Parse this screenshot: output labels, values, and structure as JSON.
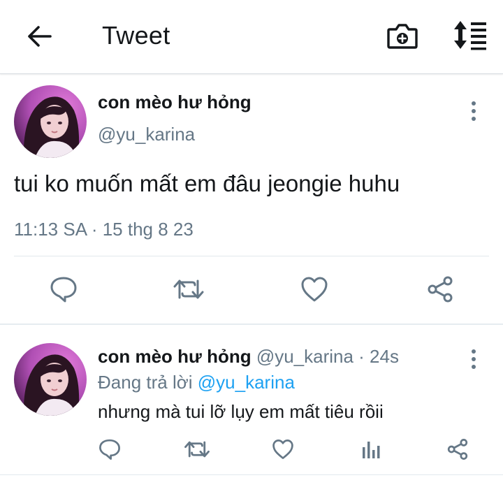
{
  "header": {
    "title": "Tweet",
    "back_icon": "arrow-left-icon",
    "camera_icon": "camera-plus-icon",
    "sort_icon": "sort-list-icon"
  },
  "main_tweet": {
    "display_name": "con mèo hư hỏng",
    "handle": "@yu_karina",
    "text": "tui ko muốn mất em đâu jeongie huhu",
    "timestamp": "11:13 SA · 15 thg 8 23",
    "actions": [
      "reply-icon",
      "retweet-icon",
      "like-icon",
      "share-icon"
    ]
  },
  "reply_tweet": {
    "display_name": "con mèo hư hỏng",
    "handle_time": " @yu_karina · 24s",
    "replying_prefix": "Đang trả lời ",
    "replying_to": "@yu_karina",
    "text": "nhưng mà tui lỡ lụy em mất tiêu rồii",
    "actions": [
      "reply-icon",
      "retweet-icon",
      "like-icon",
      "analytics-icon",
      "share-icon"
    ]
  },
  "colors": {
    "text": "#14171a",
    "secondary": "#657786",
    "link": "#1da1f2",
    "divider": "#e1e8ed"
  }
}
